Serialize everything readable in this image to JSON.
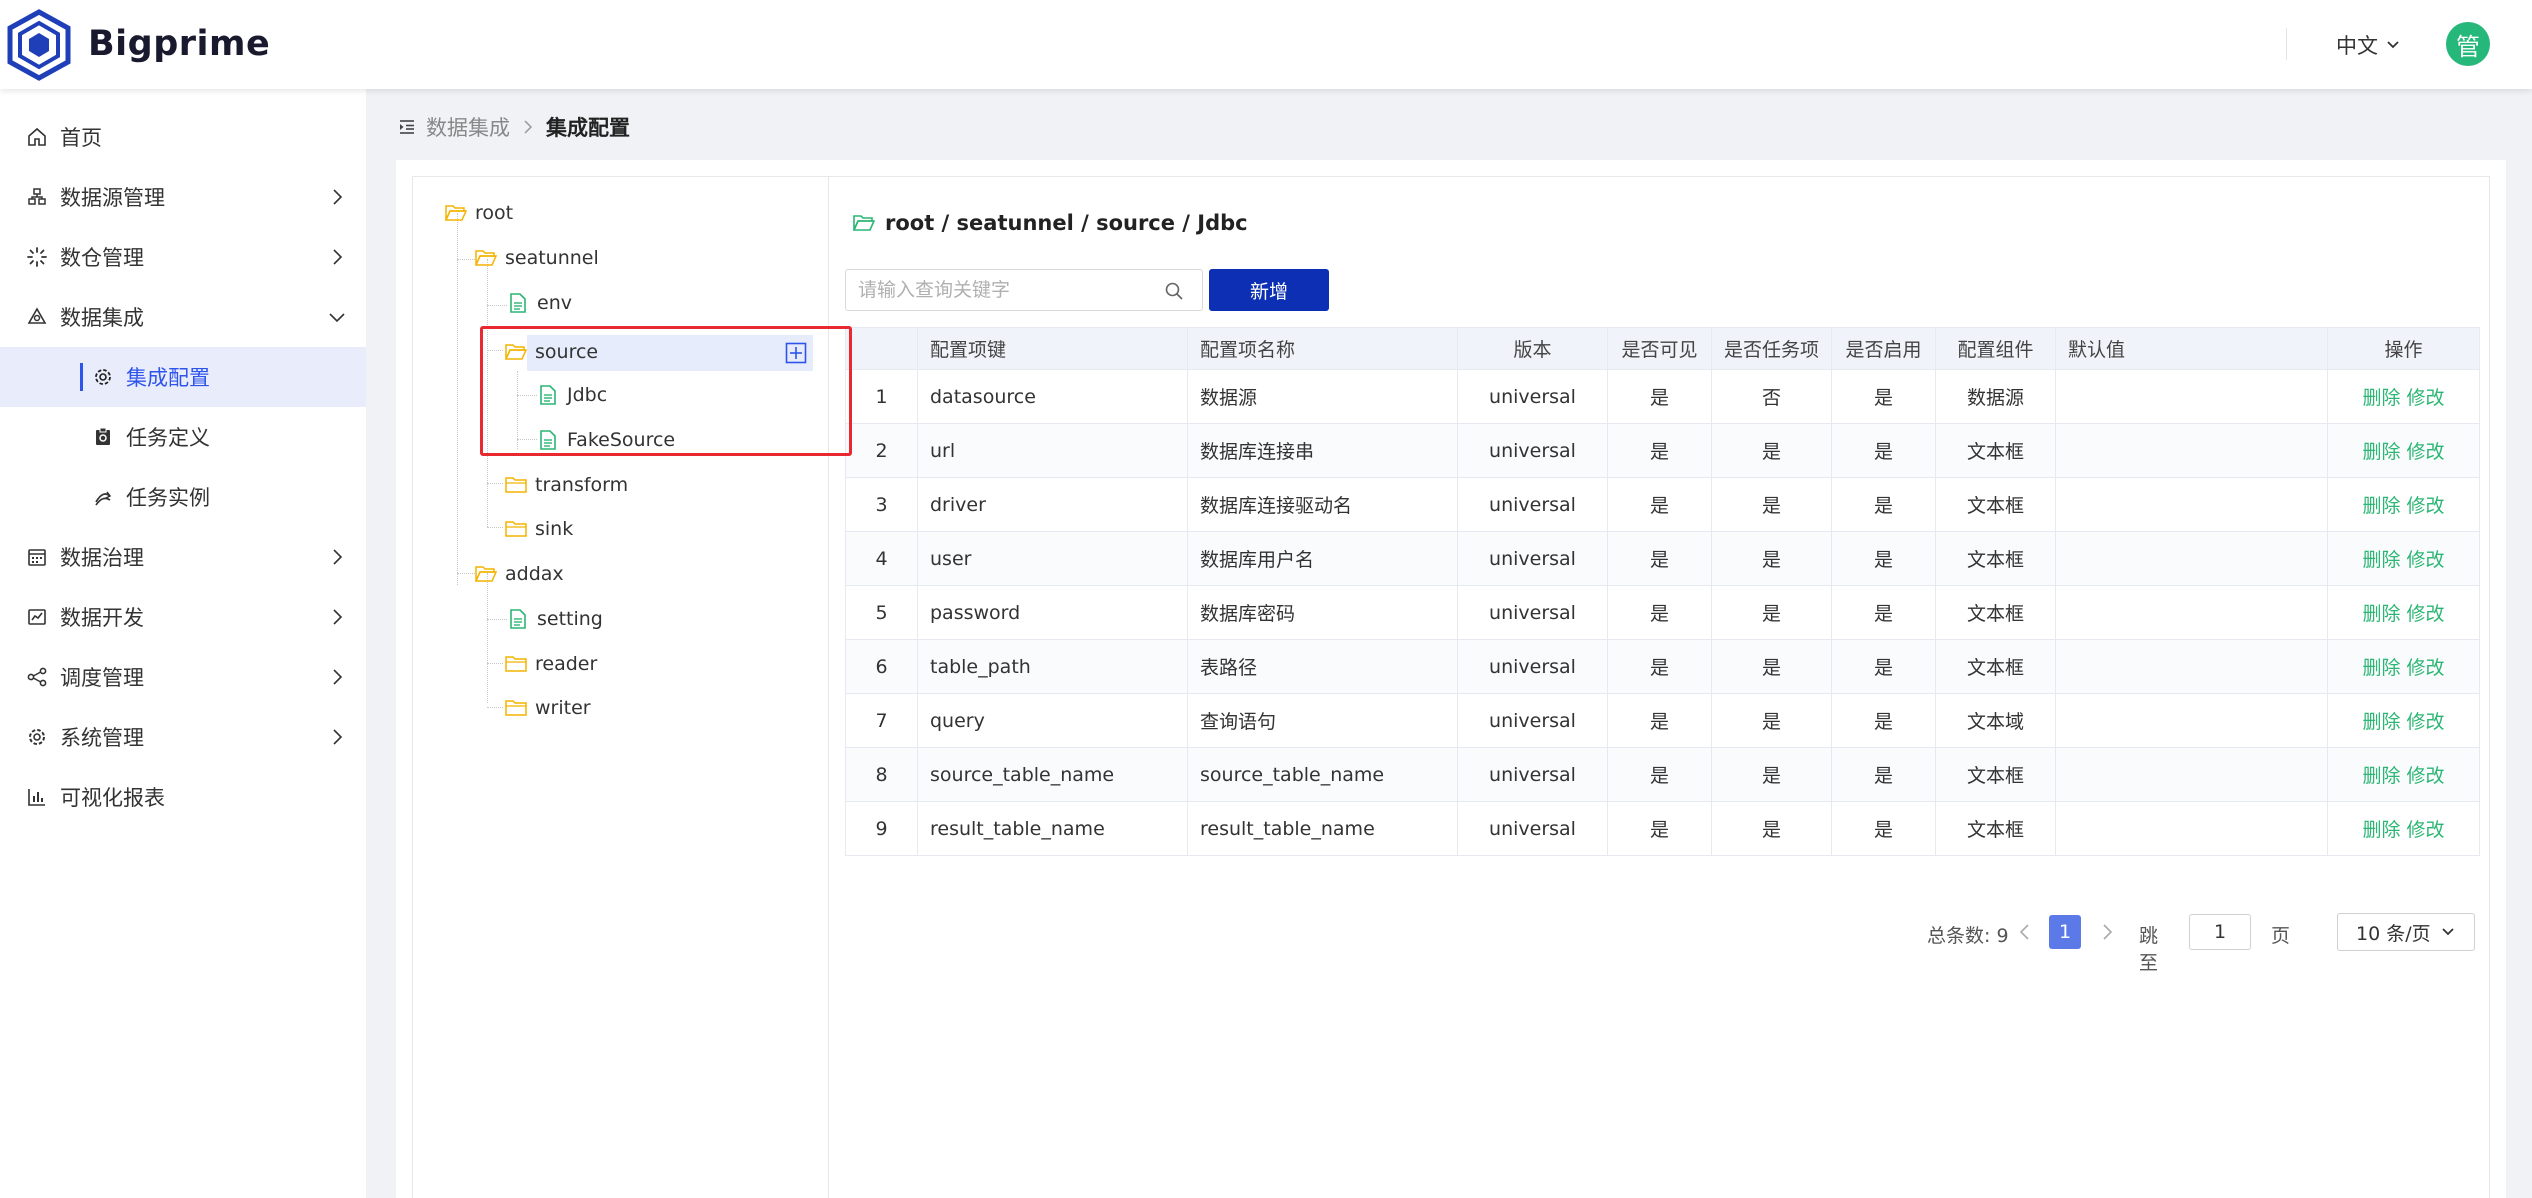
{
  "header": {
    "brand": "Bigprime",
    "language": "中文",
    "avatar_text": "管"
  },
  "sidebar": {
    "items": [
      {
        "label": "首页",
        "icon": "home-icon"
      },
      {
        "label": "数据源管理",
        "icon": "datasource-icon"
      },
      {
        "label": "数仓管理",
        "icon": "warehouse-icon"
      },
      {
        "label": "数据集成",
        "icon": "integration-icon"
      },
      {
        "label": "集成配置",
        "icon": "gear-icon"
      },
      {
        "label": "任务定义",
        "icon": "task-definition-icon"
      },
      {
        "label": "任务实例",
        "icon": "task-instance-icon"
      },
      {
        "label": "数据治理",
        "icon": "governance-icon"
      },
      {
        "label": "数据开发",
        "icon": "development-icon"
      },
      {
        "label": "调度管理",
        "icon": "schedule-icon"
      },
      {
        "label": "系统管理",
        "icon": "settings-icon"
      },
      {
        "label": "可视化报表",
        "icon": "chart-icon"
      }
    ]
  },
  "breadcrumb": {
    "parent": "数据集成",
    "current": "集成配置"
  },
  "tree": {
    "root": "root",
    "seatunnel": "seatunnel",
    "env": "env",
    "source": "source",
    "jdbc": "Jdbc",
    "fakesource": "FakeSource",
    "transform": "transform",
    "sink": "sink",
    "addax": "addax",
    "setting": "setting",
    "reader": "reader",
    "writer": "writer"
  },
  "main": {
    "path": "root / seatunnel / source / Jdbc",
    "search_placeholder": "请输入查询关键字",
    "add_label": "新增"
  },
  "table": {
    "headers": [
      "",
      "配置项键",
      "配置项名称",
      "版本",
      "是否可见",
      "是否任务项",
      "是否启用",
      "配置组件",
      "默认值",
      "操作"
    ],
    "delete_label": "删除",
    "edit_label": "修改",
    "rows": [
      {
        "no": "1",
        "key": "datasource",
        "name": "数据源",
        "version": "universal",
        "visible": "是",
        "task": "否",
        "enabled": "是",
        "component": "数据源",
        "default": ""
      },
      {
        "no": "2",
        "key": "url",
        "name": "数据库连接串",
        "version": "universal",
        "visible": "是",
        "task": "是",
        "enabled": "是",
        "component": "文本框",
        "default": ""
      },
      {
        "no": "3",
        "key": "driver",
        "name": "数据库连接驱动名",
        "version": "universal",
        "visible": "是",
        "task": "是",
        "enabled": "是",
        "component": "文本框",
        "default": ""
      },
      {
        "no": "4",
        "key": "user",
        "name": "数据库用户名",
        "version": "universal",
        "visible": "是",
        "task": "是",
        "enabled": "是",
        "component": "文本框",
        "default": ""
      },
      {
        "no": "5",
        "key": "password",
        "name": "数据库密码",
        "version": "universal",
        "visible": "是",
        "task": "是",
        "enabled": "是",
        "component": "文本框",
        "default": ""
      },
      {
        "no": "6",
        "key": "table_path",
        "name": "表路径",
        "version": "universal",
        "visible": "是",
        "task": "是",
        "enabled": "是",
        "component": "文本框",
        "default": ""
      },
      {
        "no": "7",
        "key": "query",
        "name": "查询语句",
        "version": "universal",
        "visible": "是",
        "task": "是",
        "enabled": "是",
        "component": "文本域",
        "default": ""
      },
      {
        "no": "8",
        "key": "source_table_name",
        "name": "source_table_name",
        "version": "universal",
        "visible": "是",
        "task": "是",
        "enabled": "是",
        "component": "文本框",
        "default": ""
      },
      {
        "no": "9",
        "key": "result_table_name",
        "name": "result_table_name",
        "version": "universal",
        "visible": "是",
        "task": "是",
        "enabled": "是",
        "component": "文本框",
        "default": ""
      }
    ]
  },
  "pagination": {
    "total_label": "总条数: 9",
    "current_page": "1",
    "jump_label": "跳至",
    "jump_value": "1",
    "page_label": "页",
    "page_size": "10 条/页"
  },
  "colors": {
    "accent": "#2f54eb",
    "primary_button": "#0c2fb3",
    "action_link": "#2bb673",
    "negative": "#e8292f",
    "folder": "#f4b400",
    "file": "#2bb673",
    "avatar": "#25b87a"
  }
}
